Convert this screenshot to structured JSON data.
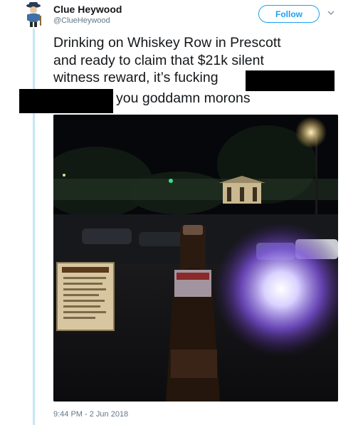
{
  "tweet": {
    "display_name": "Clue Heywood",
    "handle": "@ClueHeywood",
    "follow_label": "Follow",
    "text_lines": [
      "Drinking on Whiskey Row in Prescott",
      "and ready to claim that $21k silent",
      "witness reward, it’s fucking",
      "you goddamn morons"
    ],
    "timestamp": "9:44 PM - 2 Jun 2018",
    "photo_description_icon": "photo",
    "accent_color": "#1da1f2"
  }
}
